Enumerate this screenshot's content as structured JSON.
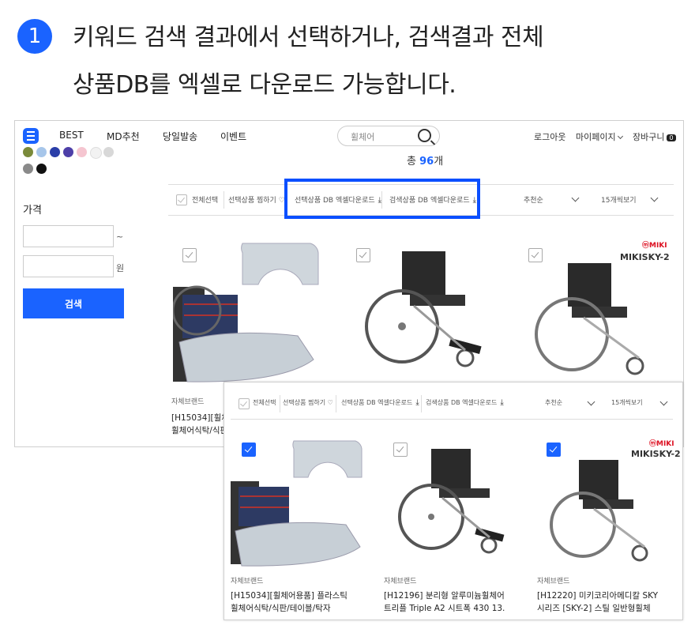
{
  "instruction": {
    "step_number": "1",
    "line1": "키워드 검색 결과에서 선택하거나, 검색결과 전체",
    "line2": "상품DB를 엑셀로 다운로드 가능합니다."
  },
  "header": {
    "nav": [
      "BEST",
      "MD추천",
      "당일발송",
      "이벤트"
    ],
    "search_placeholder": "휠체어",
    "utils": [
      "로그아웃",
      "마이페이지",
      "장바구니"
    ],
    "cart_count": "0"
  },
  "sidebar": {
    "swatch_colors": [
      "#7a8a3a",
      "#a7c6ea",
      "#2a3ea8",
      "#4d3fa8",
      "#f5c5d0",
      "#f2f2f2",
      "#d8d8d8",
      "#8a8a8a",
      "#111111"
    ],
    "price_label": "가격",
    "price_from_suffix": "~",
    "price_to_suffix": "원",
    "search_button": "검색"
  },
  "results": {
    "total_prefix": "총",
    "total_count": "96",
    "total_suffix": "개"
  },
  "toolbar": {
    "select_all": "전체선택",
    "wishlist_selected": "선택상품 찜하기",
    "download_selected": "선택상품 DB 엑셀다운로드",
    "download_search": "검색상품 DB 엑셀다운로드",
    "sort": "추천순",
    "per_page": "15개씩보기"
  },
  "products": [
    {
      "brand": "자체브랜드",
      "name_line1": "[H15034][휠체어용품] 플라스틱",
      "name_line2": "휠체어식탁/식판/테이블/탁자"
    },
    {
      "brand": "자체브랜드",
      "name_line1": "[H12196] 분리형 알루미늄휠체어",
      "name_line2": "트리플 Triple A2 시트폭 430 13."
    },
    {
      "brand": "자체브랜드",
      "name_line1": "[H12220] 미키코리아메디칼 SKY",
      "name_line2": "시리즈 [SKY-2] 스틸 일반형휠체"
    }
  ],
  "back_product": {
    "brand": "자체브랜드",
    "name_line1": "[H15034][휠체",
    "name_line2": "휠체어식탁/식판"
  },
  "miki": {
    "logo": "ⓜMIKI",
    "model": "MIKISKY-2"
  }
}
